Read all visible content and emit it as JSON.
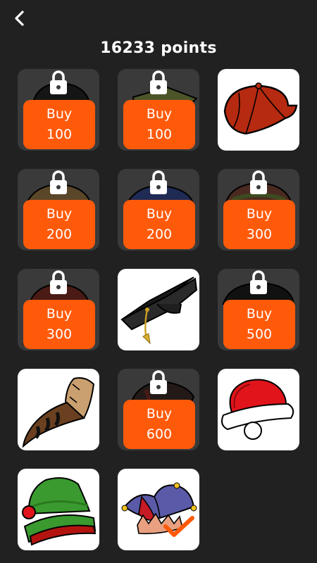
{
  "header": {
    "back_icon": "chevron-left-icon",
    "points_text": "16233 points"
  },
  "colors": {
    "background": "#212121",
    "tile_locked": "#3a3a3a",
    "tile_owned": "#ffffff",
    "buy_button": "#ff5a0a"
  },
  "shop": {
    "items": [
      {
        "name": "black-cap",
        "locked": true,
        "buy_label": "Buy",
        "price": "100"
      },
      {
        "name": "green-cap",
        "locked": true,
        "buy_label": "Buy",
        "price": "100"
      },
      {
        "name": "red-newsboy-cap",
        "locked": false
      },
      {
        "name": "brown-cap",
        "locked": true,
        "buy_label": "Buy",
        "price": "200"
      },
      {
        "name": "navy-cap",
        "locked": true,
        "buy_label": "Buy",
        "price": "200"
      },
      {
        "name": "dark-red-cap",
        "locked": true,
        "buy_label": "Buy",
        "price": "300"
      },
      {
        "name": "red-beanie",
        "locked": true,
        "buy_label": "Buy",
        "price": "300"
      },
      {
        "name": "graduation-cap",
        "locked": false
      },
      {
        "name": "black-beanie",
        "locked": true,
        "buy_label": "Buy",
        "price": "500"
      },
      {
        "name": "coonskin-hat",
        "locked": false
      },
      {
        "name": "dark-hat",
        "locked": true,
        "buy_label": "Buy",
        "price": "600"
      },
      {
        "name": "santa-hat",
        "locked": false
      },
      {
        "name": "elf-hat",
        "locked": false
      },
      {
        "name": "jester-hat",
        "locked": false,
        "selected": true
      }
    ]
  }
}
